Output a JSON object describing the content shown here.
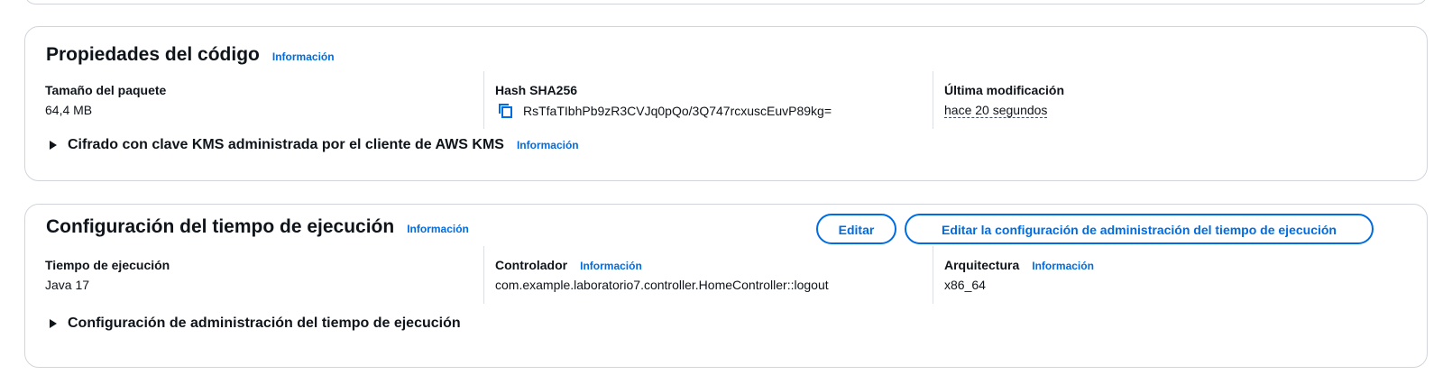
{
  "code_properties": {
    "title": "Propiedades del código",
    "info": "Información",
    "package_size": {
      "label": "Tamaño del paquete",
      "value": "64,4 MB"
    },
    "hash": {
      "label": "Hash SHA256",
      "value": "RsTfaTIbhPb9zR3CVJq0pQo/3Q747rcxuscEuvP89kg="
    },
    "last_modified": {
      "label": "Última modificación",
      "value": "hace 20 segundos"
    },
    "kms_expander": {
      "label": "Cifrado con clave KMS administrada por el cliente de AWS KMS",
      "info": "Información"
    }
  },
  "runtime_settings": {
    "title": "Configuración del tiempo de ejecución",
    "info": "Información",
    "edit_button": "Editar",
    "edit_runtime_mgmt_button": "Editar la configuración de administración del tiempo de ejecución",
    "runtime": {
      "label": "Tiempo de ejecución",
      "value": "Java 17"
    },
    "handler": {
      "label": "Controlador",
      "info": "Información",
      "value": "com.example.laboratorio7.controller.HomeController::logout"
    },
    "architecture": {
      "label": "Arquitectura",
      "info": "Información",
      "value": "x86_64"
    },
    "runtime_mgmt_expander": {
      "label": "Configuración de administración del tiempo de ejecución"
    }
  },
  "icons": {
    "copy": "copy-icon",
    "expand": "caret-right-icon"
  },
  "colors": {
    "link": "#006ce0",
    "text": "#0f141a",
    "border": "#d1d5db"
  }
}
